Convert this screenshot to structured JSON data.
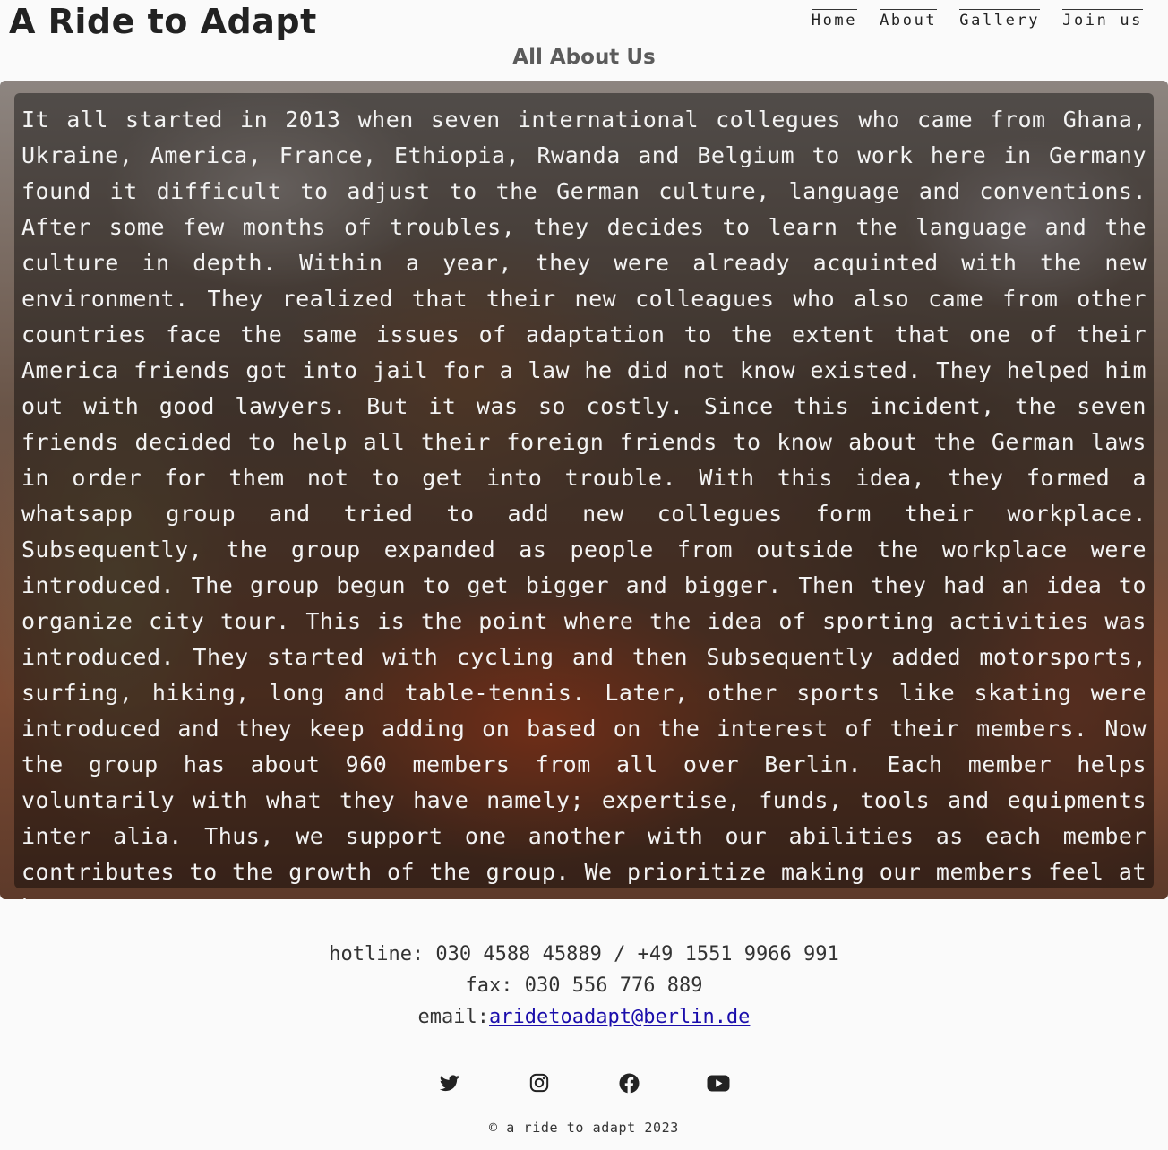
{
  "header": {
    "site_title": "A Ride to Adapt",
    "nav": [
      {
        "label": "Home"
      },
      {
        "label": "About"
      },
      {
        "label": "Gallery"
      },
      {
        "label": "Join us"
      }
    ]
  },
  "main": {
    "heading": "All About Us",
    "about_text": "It all started in 2013 when seven international collegues who came from Ghana, Ukraine, America, France, Ethiopia, Rwanda and Belgium to work here in Germany found it difficult to adjust to the German culture, language and conventions. After some few months of troubles, they decides to learn the language and the culture in depth. Within a year, they were already acquinted with the new environment. They realized that their new colleagues who also came from other countries face the same issues of adaptation to the extent that one of their America friends got into jail for a law he did not know existed. They helped him out with good lawyers. But it was so costly. Since this incident, the seven friends decided to help all their foreign friends to know about the German laws in order for them not to get into trouble. With this idea, they formed a whatsapp group and tried to add new collegues form their workplace. Subsequently, the group expanded as people from outside the workplace were introduced. The group begun to get bigger and bigger. Then they had an idea to organize city tour. This is the point where the idea of sporting activities was introduced. They started with cycling and then Subsequently added motorsports, surfing, hiking, long and table-tennis. Later, other sports like skating were introduced and they keep adding on based on the interest of their members. Now the group has about 960 members from all over Berlin. Each member helps voluntarily with what they have namely; expertise, funds, tools and equipments inter alia. Thus, we support one another with our abilities as each member contributes to the growth of the group. We prioritize making our members feel at home."
  },
  "footer": {
    "hotline": "hotline: 030 4588 45889 / +49 1551 9966 991",
    "fax": "fax: 030 556 776 889",
    "email_label": "email:",
    "email": "aridetoadapt@berlin.de",
    "social_icons": [
      "twitter-icon",
      "instagram-icon",
      "facebook-icon",
      "youtube-icon"
    ],
    "copyright": "© a ride to adapt 2023"
  }
}
